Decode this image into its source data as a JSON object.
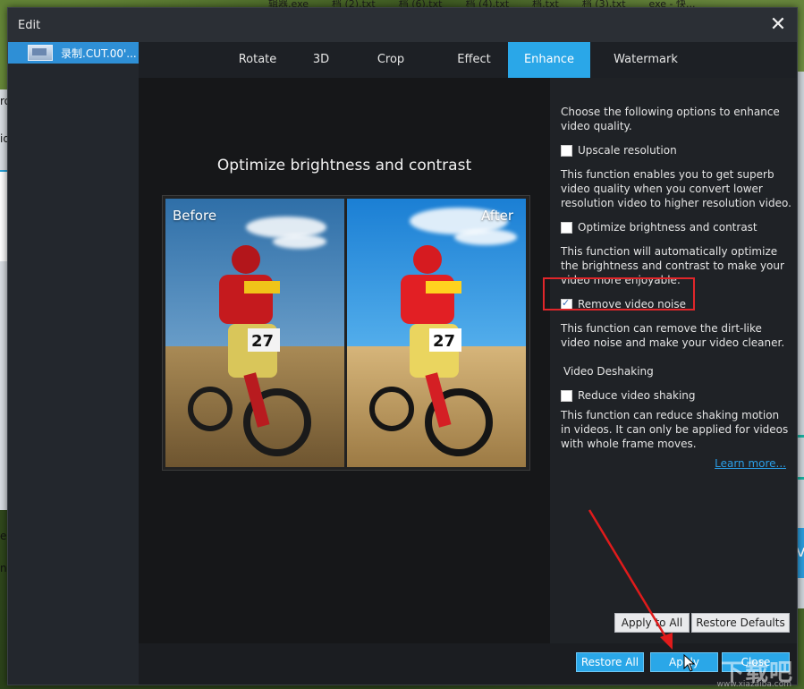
{
  "background": {
    "taskbar_files": [
      "辑器.exe",
      "档 (2).txt",
      "档 (6).txt",
      "档 (4).txt",
      "档.txt",
      "档 (3).txt",
      "exe - 快..."
    ],
    "left_fragments": [
      "ro",
      "id",
      "e:",
      "n:"
    ],
    "right_fragment": "v"
  },
  "dialog": {
    "title": "Edit",
    "close_icon": "close-icon"
  },
  "file_list": {
    "items": [
      {
        "name": "录制.CUT.00'..."
      }
    ]
  },
  "tabs": [
    {
      "label": "Rotate"
    },
    {
      "label": "3D"
    },
    {
      "label": "Crop"
    },
    {
      "label": "Effect"
    },
    {
      "label": "Enhance",
      "active": true
    },
    {
      "label": "Watermark"
    }
  ],
  "preview": {
    "title": "Optimize brightness and contrast",
    "before_label": "Before",
    "after_label": "After"
  },
  "options": {
    "intro": "Choose the following options to enhance video quality.",
    "upscale": {
      "label": "Upscale resolution",
      "checked": false,
      "desc": "This function enables you to get superb video quality when you convert lower resolution video to higher resolution video."
    },
    "brightness": {
      "label": "Optimize brightness and contrast",
      "checked": false,
      "desc": "This function will automatically optimize the brightness and contrast to make your video more enjoyable."
    },
    "noise": {
      "label": "Remove video noise",
      "checked": true,
      "desc": "This function can remove the dirt-like video noise and make your video cleaner."
    },
    "deshake_heading": "Video Deshaking",
    "deshake": {
      "label": "Reduce video shaking",
      "checked": false,
      "desc": "This function can reduce shaking motion in videos. It can only be applied for videos with whole frame moves."
    },
    "learn_more": "Learn more..."
  },
  "buttons": {
    "apply_to_all": "Apply to All",
    "restore_defaults": "Restore Defaults",
    "restore_all": "Restore All",
    "apply": "Apply",
    "close": "Close"
  },
  "watermark": {
    "text": "下载吧",
    "url": "www.xiazaiba.com"
  },
  "colors": {
    "accent": "#2aa7e8",
    "highlight_box": "#e0262a",
    "arrow": "#e01b1b",
    "dialog_bg": "#1c1f24"
  }
}
